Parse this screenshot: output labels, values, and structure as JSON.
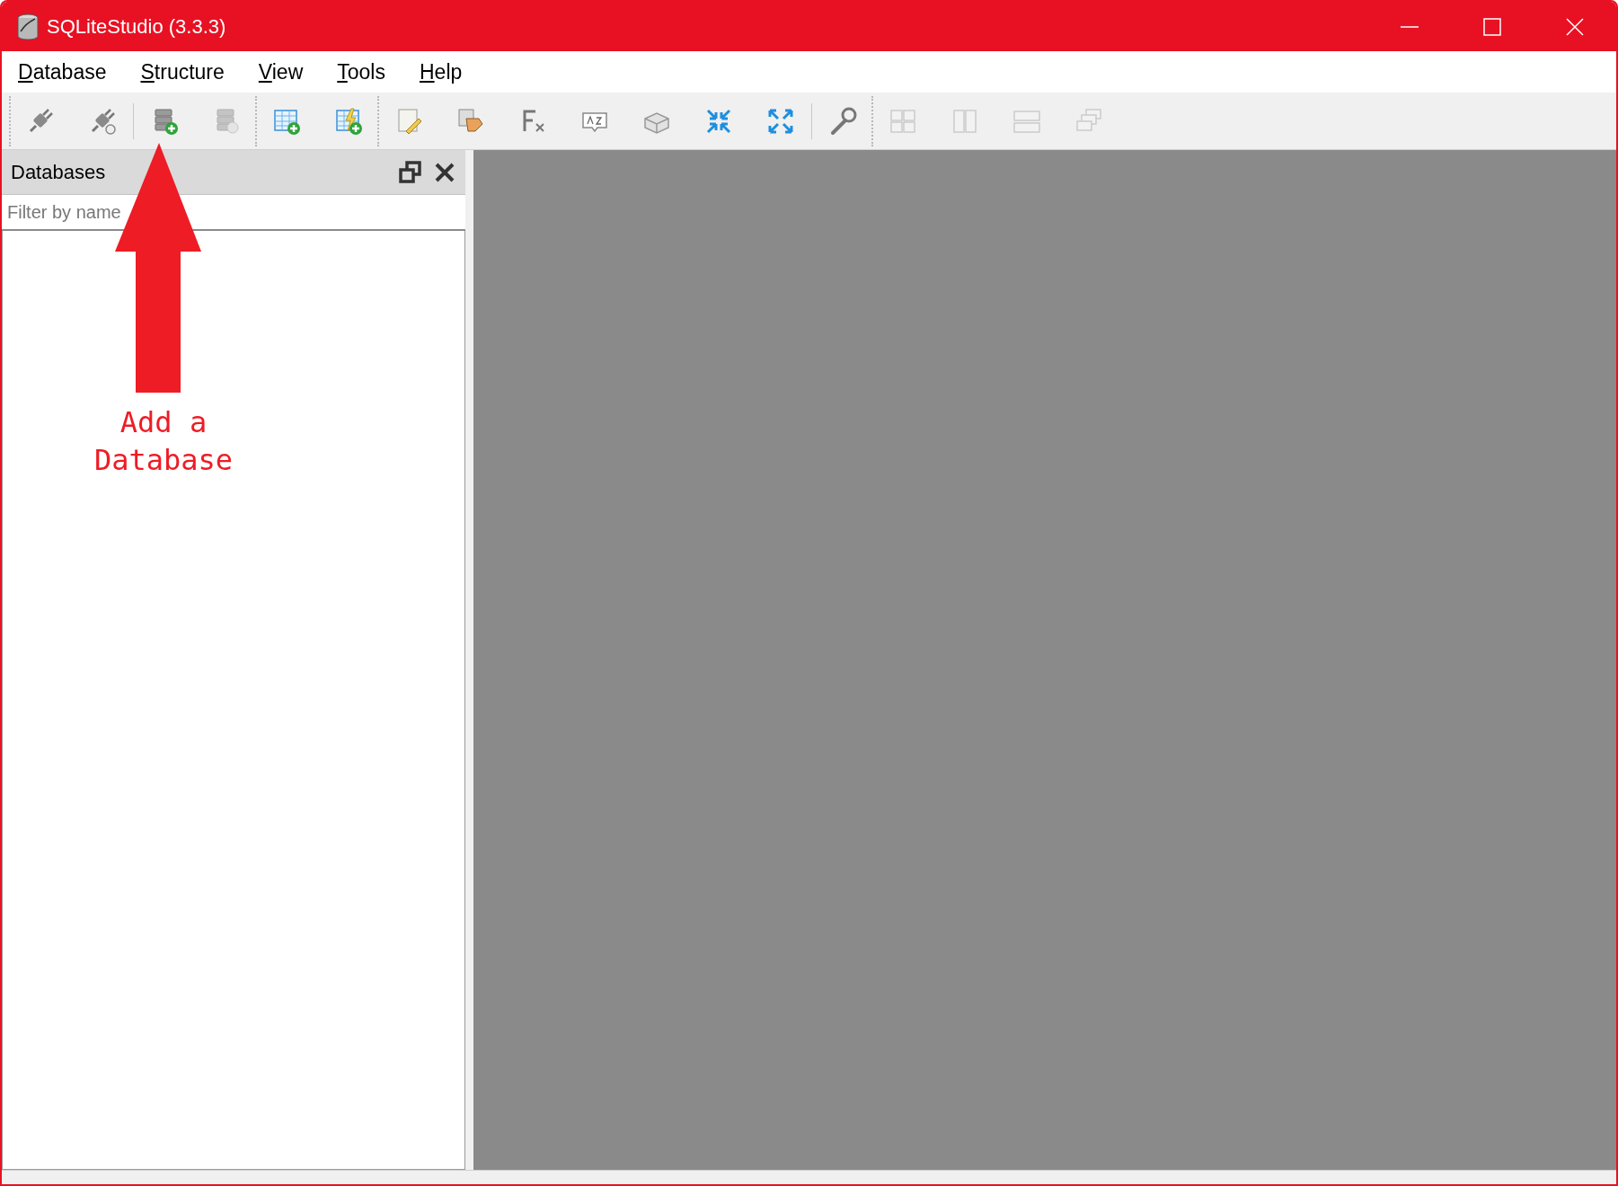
{
  "window": {
    "title": "SQLiteStudio (3.3.3)"
  },
  "menu": [
    {
      "label": "Database"
    },
    {
      "label": "Structure"
    },
    {
      "label": "View"
    },
    {
      "label": "Tools"
    },
    {
      "label": "Help"
    }
  ],
  "databases_panel": {
    "title": "Databases",
    "filter": {
      "placeholder": "Filter by name"
    }
  },
  "annotation": {
    "text": "Add a Database"
  }
}
